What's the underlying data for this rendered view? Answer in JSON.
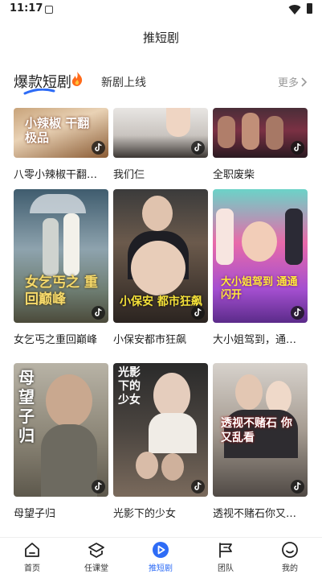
{
  "status_bar": {
    "time": "11:17"
  },
  "header": {
    "title": "推短剧"
  },
  "tabs": {
    "active_label": "爆款短剧",
    "inactive_label": "新剧上线",
    "more_label": "更多"
  },
  "grid": {
    "row1": [
      {
        "title": "八零小辣椒干翻…",
        "poster_text": "小辣椒 干翻极品"
      },
      {
        "title": "我们仨"
      },
      {
        "title": "全职废柴"
      }
    ],
    "row2": [
      {
        "title": "女乞丐之重回巅峰",
        "poster_text": "女乞丐之 重回巅峰"
      },
      {
        "title": "小保安都市狂飙",
        "poster_text": "小保安 都市狂飙"
      },
      {
        "title": "大小姐驾到，通…",
        "poster_text": "大小姐驾到 通通闪开"
      }
    ],
    "row3": [
      {
        "title": "母望子归",
        "poster_text": "母望子归"
      },
      {
        "title": "光影下的少女",
        "poster_text": "光影下的少女"
      },
      {
        "title": "透视不赌石你又…",
        "poster_text": "透视不赌石 你又乱看"
      }
    ]
  },
  "bottom_nav": [
    {
      "label": "首页",
      "icon": "home-icon"
    },
    {
      "label": "任课堂",
      "icon": "layers-icon"
    },
    {
      "label": "推短剧",
      "icon": "play-circle-icon",
      "active": true
    },
    {
      "label": "团队",
      "icon": "flag-icon"
    },
    {
      "label": "我的",
      "icon": "smile-icon"
    }
  ],
  "colors": {
    "accent": "#2e6cf6",
    "fire": "#ff6a1a"
  }
}
